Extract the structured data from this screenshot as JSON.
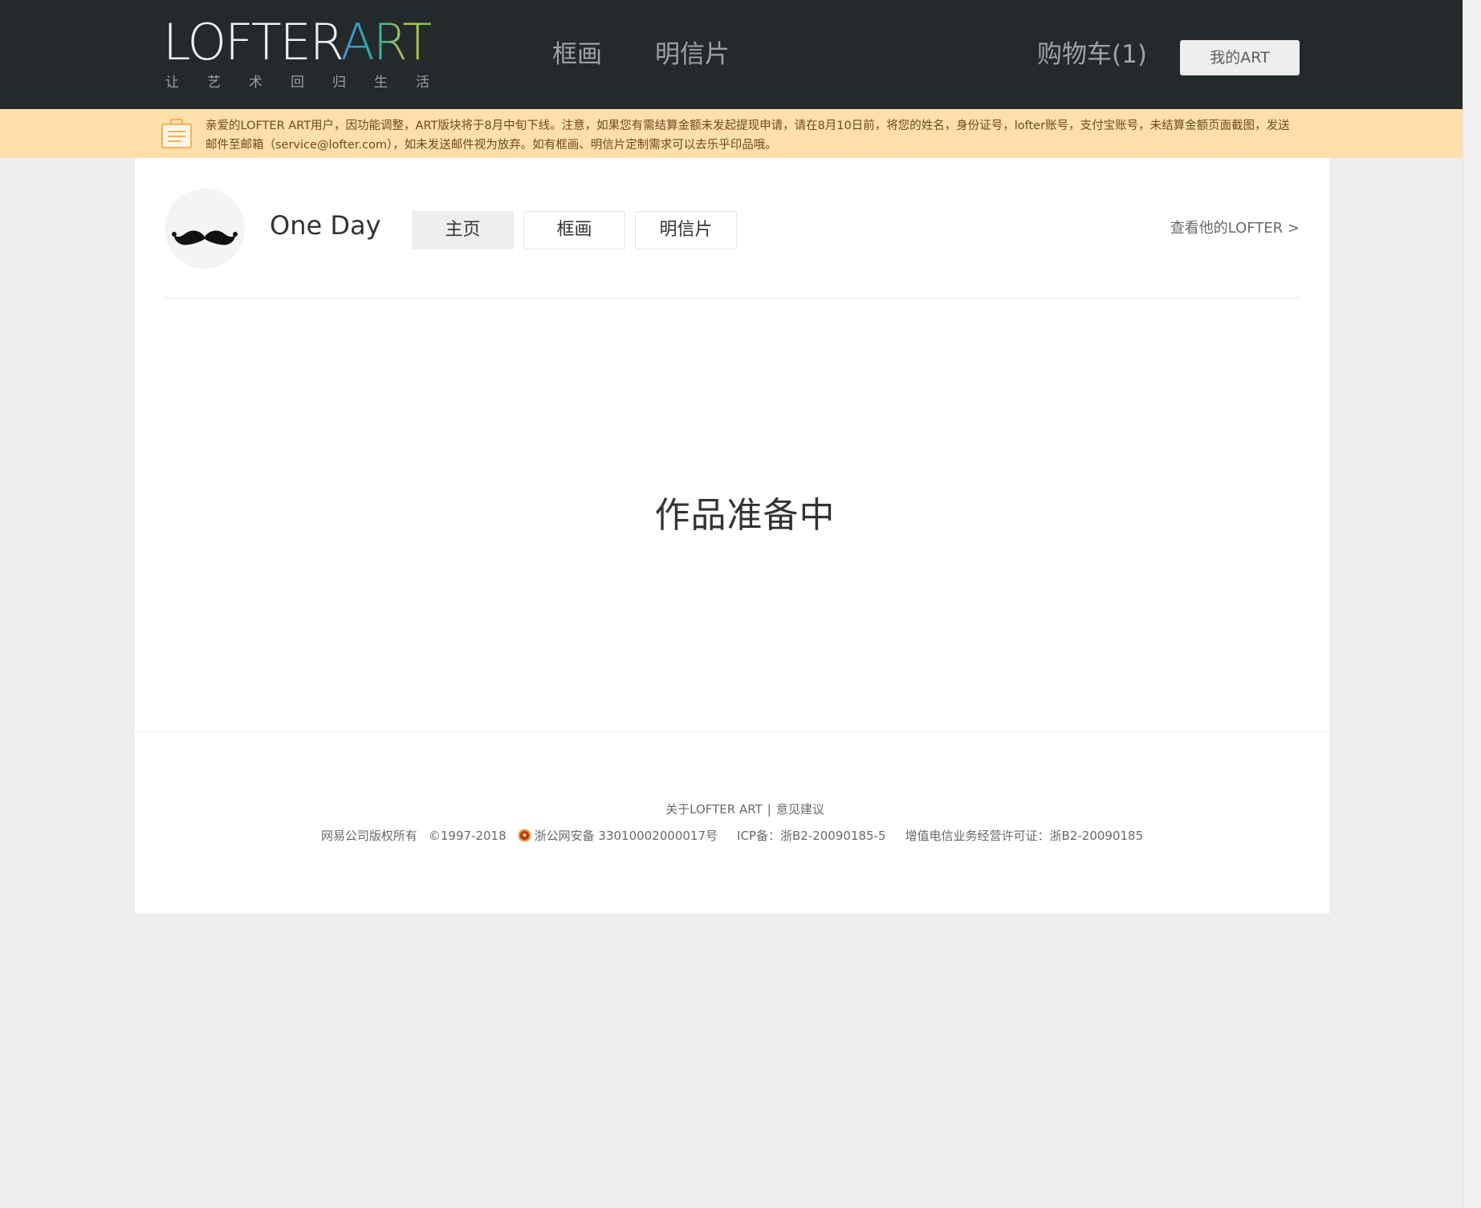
{
  "header": {
    "logo_main": "LOFTER",
    "logo_accent": "ART",
    "logo_slogan": "让艺术回归生活",
    "nav": {
      "frame": "框画",
      "postcard": "明信片"
    },
    "cart_label": "购物车(1)",
    "my_art_label": "我的ART"
  },
  "notice": {
    "icon": "notice-board-icon",
    "text": "亲爱的LOFTER ART用户，因功能调整，ART版块将于8月中旬下线。注意，如果您有需结算金额未发起提现申请，请在8月10日前，将您的姓名，身份证号，lofter账号，支付宝账号，未结算金额页面截图，发送邮件至邮箱（service@lofter.com），如未发送邮件视为放弃。如有框画、明信片定制需求可以去乐乎印品哦。"
  },
  "profile": {
    "avatar_icon": "mustache-icon",
    "name": "One Day",
    "tabs": {
      "home": "主页",
      "frame": "框画",
      "postcard": "明信片"
    },
    "active_tab": "home",
    "view_lofter_link": "查看他的LOFTER >"
  },
  "main": {
    "empty_message": "作品准备中"
  },
  "footer": {
    "about_link": "关于LOFTER ART",
    "separator": "|",
    "feedback_link": "意见建议",
    "copyright_owner": "网易公司版权所有",
    "copyright_years": "©1997-2018",
    "police_icon": "police-badge-icon",
    "police_record": "浙公网安备 33010002000017号",
    "icp": "ICP备：浙B2-20090185-5",
    "license": "增值电信业务经营许可证：浙B2-20090185"
  },
  "colors": {
    "topbar_bg": "#24292c",
    "notice_bg": "#ffdfaa",
    "page_bg": "#ecedef",
    "card_bg": "#ffffff"
  }
}
